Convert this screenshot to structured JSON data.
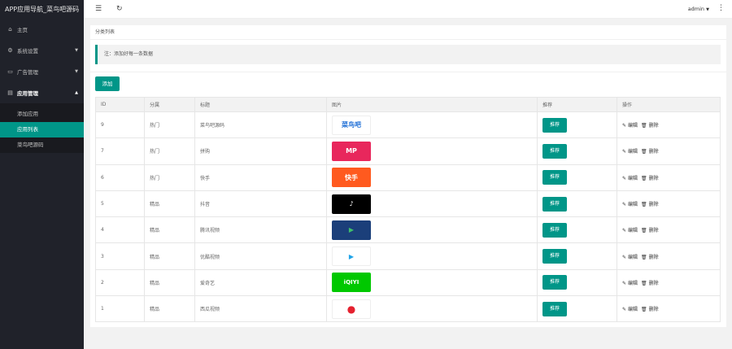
{
  "brand": "APP应用导航_菜鸟吧源码",
  "sidebar": {
    "items": [
      {
        "label": "主页",
        "icon": "home-icon"
      },
      {
        "label": "系统设置",
        "icon": "gear-icon"
      },
      {
        "label": "广告管理",
        "icon": "ad-icon"
      },
      {
        "label": "应用管理",
        "icon": "app-icon"
      }
    ],
    "sub": [
      {
        "label": "添加应用"
      },
      {
        "label": "应用列表"
      },
      {
        "label": "菜鸟吧源码"
      }
    ]
  },
  "header": {
    "user": "admin"
  },
  "breadcrumb": "分类列表",
  "note": "注：添加好每一条数据",
  "add_label": "添加",
  "table": {
    "headers": [
      "ID",
      "分属",
      "标题",
      "图片",
      "推荐",
      "操作"
    ],
    "rows": [
      {
        "id": "9",
        "cat": "热门",
        "title": "菜鸟吧源码",
        "thumb": "菜鸟吧",
        "rec": "推荐",
        "edit": "编辑",
        "del": "删除"
      },
      {
        "id": "7",
        "cat": "热门",
        "title": "拼购",
        "thumb": "MP",
        "rec": "推荐",
        "edit": "编辑",
        "del": "删除"
      },
      {
        "id": "6",
        "cat": "热门",
        "title": "快手",
        "thumb": "快手",
        "rec": "推荐",
        "edit": "编辑",
        "del": "删除"
      },
      {
        "id": "5",
        "cat": "精品",
        "title": "抖音",
        "thumb": "♪",
        "rec": "推荐",
        "edit": "编辑",
        "del": "删除"
      },
      {
        "id": "4",
        "cat": "精品",
        "title": "腾讯视频",
        "thumb": "▶",
        "rec": "推荐",
        "edit": "编辑",
        "del": "删除"
      },
      {
        "id": "3",
        "cat": "精品",
        "title": "优酷视频",
        "thumb": "▶",
        "rec": "推荐",
        "edit": "编辑",
        "del": "删除"
      },
      {
        "id": "2",
        "cat": "精品",
        "title": "爱奇艺",
        "thumb": "iQIYI",
        "rec": "推荐",
        "edit": "编辑",
        "del": "删除"
      },
      {
        "id": "1",
        "cat": "精品",
        "title": "西瓜视频",
        "thumb": "●",
        "rec": "推荐",
        "edit": "编辑",
        "del": "删除"
      }
    ]
  },
  "colors": {
    "accent": "#009688",
    "sidebar": "#20222a"
  }
}
